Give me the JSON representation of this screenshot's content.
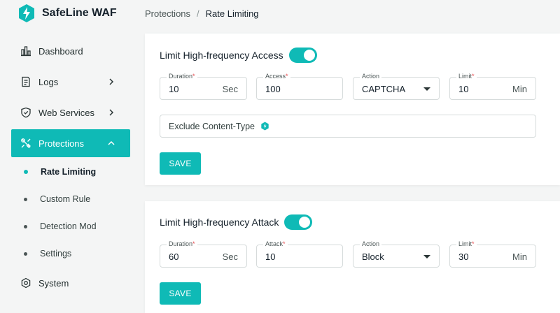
{
  "brand": {
    "name": "SafeLine WAF",
    "accent": "#0fbab6"
  },
  "sidebar": {
    "items": [
      {
        "label": "Dashboard",
        "icon": "bar-chart-icon"
      },
      {
        "label": "Logs",
        "icon": "document-icon"
      },
      {
        "label": "Web Services",
        "icon": "shield-icon"
      },
      {
        "label": "Protections",
        "icon": "tools-icon",
        "active": true
      },
      {
        "label": "System",
        "icon": "gear-icon"
      }
    ],
    "sub_items": [
      {
        "label": "Rate Limiting",
        "active": true
      },
      {
        "label": "Custom Rule"
      },
      {
        "label": "Detection Mod"
      },
      {
        "label": "Settings"
      }
    ]
  },
  "breadcrumb": {
    "parent": "Protections",
    "separator": "/",
    "current": "Rate Limiting"
  },
  "access_card": {
    "title": "Limit High-frequency Access",
    "enabled": true,
    "duration": {
      "label": "Duration",
      "value": "10",
      "unit": "Sec"
    },
    "access": {
      "label": "Access",
      "value": "100"
    },
    "action": {
      "label": "Action",
      "value": "CAPTCHA"
    },
    "limit": {
      "label": "Limit",
      "value": "10",
      "unit": "Min"
    },
    "exclude_label": "Exclude Content-Type",
    "save_label": "SAVE"
  },
  "attack_card": {
    "title": "Limit High-frequency Attack",
    "enabled": true,
    "duration": {
      "label": "Duration",
      "value": "60",
      "unit": "Sec"
    },
    "attack": {
      "label": "Attack",
      "value": "10"
    },
    "action": {
      "label": "Action",
      "value": "Block"
    },
    "limit": {
      "label": "Limit",
      "value": "30",
      "unit": "Min"
    },
    "save_label": "SAVE"
  }
}
